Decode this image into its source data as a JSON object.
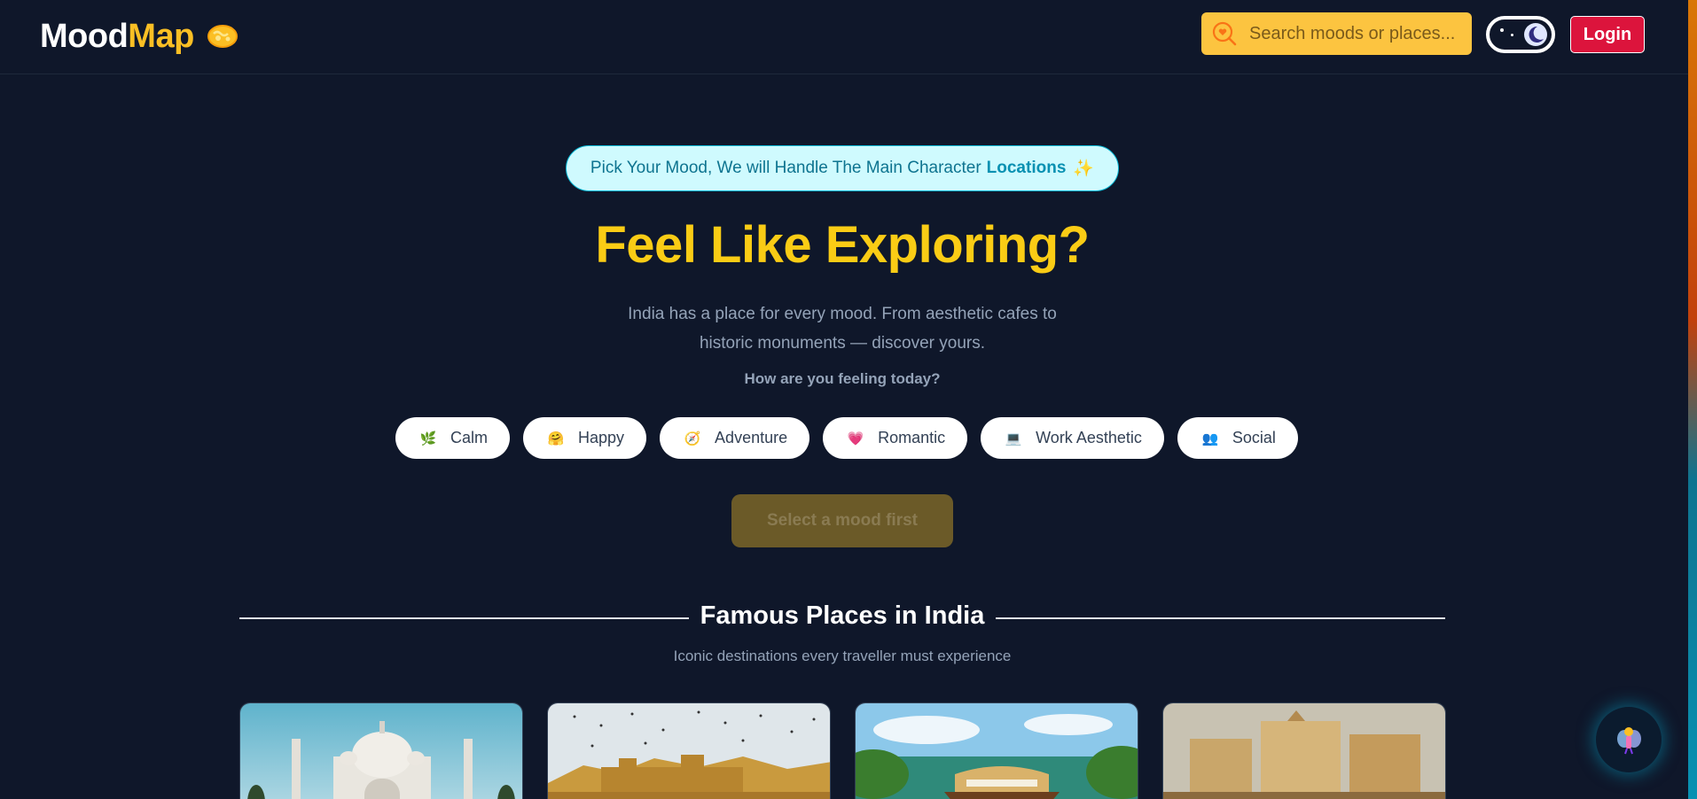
{
  "header": {
    "logo_part1": "Mood",
    "logo_part2": "Map",
    "search_placeholder": "Search moods or places...",
    "login_label": "Login"
  },
  "hero": {
    "tagline_text": "Pick Your Mood, We will Handle The Main Character",
    "tagline_highlight": "Locations",
    "tagline_emoji": "✨",
    "title": "Feel Like Exploring?",
    "subtitle": "India has a place for every mood. From aesthetic cafes to historic monuments — discover yours.",
    "prompt": "How are you feeling today?",
    "moods": [
      {
        "label": "Calm",
        "icon": "🌿"
      },
      {
        "label": "Happy",
        "icon": "🤗"
      },
      {
        "label": "Adventure",
        "icon": "🧭"
      },
      {
        "label": "Romantic",
        "icon": "💗"
      },
      {
        "label": "Work Aesthetic",
        "icon": "💻"
      },
      {
        "label": "Social",
        "icon": "👥"
      }
    ],
    "select_button_label": "Select a mood first"
  },
  "famous": {
    "title": "Famous Places in India",
    "subtitle": "Iconic destinations every traveller must experience",
    "cards": [
      {
        "image": "taj-mahal"
      },
      {
        "image": "fort-with-birds"
      },
      {
        "image": "kerala-houseboat"
      },
      {
        "image": "varanasi-ghats"
      }
    ]
  },
  "colors": {
    "background": "#0f172a",
    "accent_yellow": "#facc15",
    "login_red": "#dc143c",
    "tagline_cyan": "#cffafe"
  }
}
